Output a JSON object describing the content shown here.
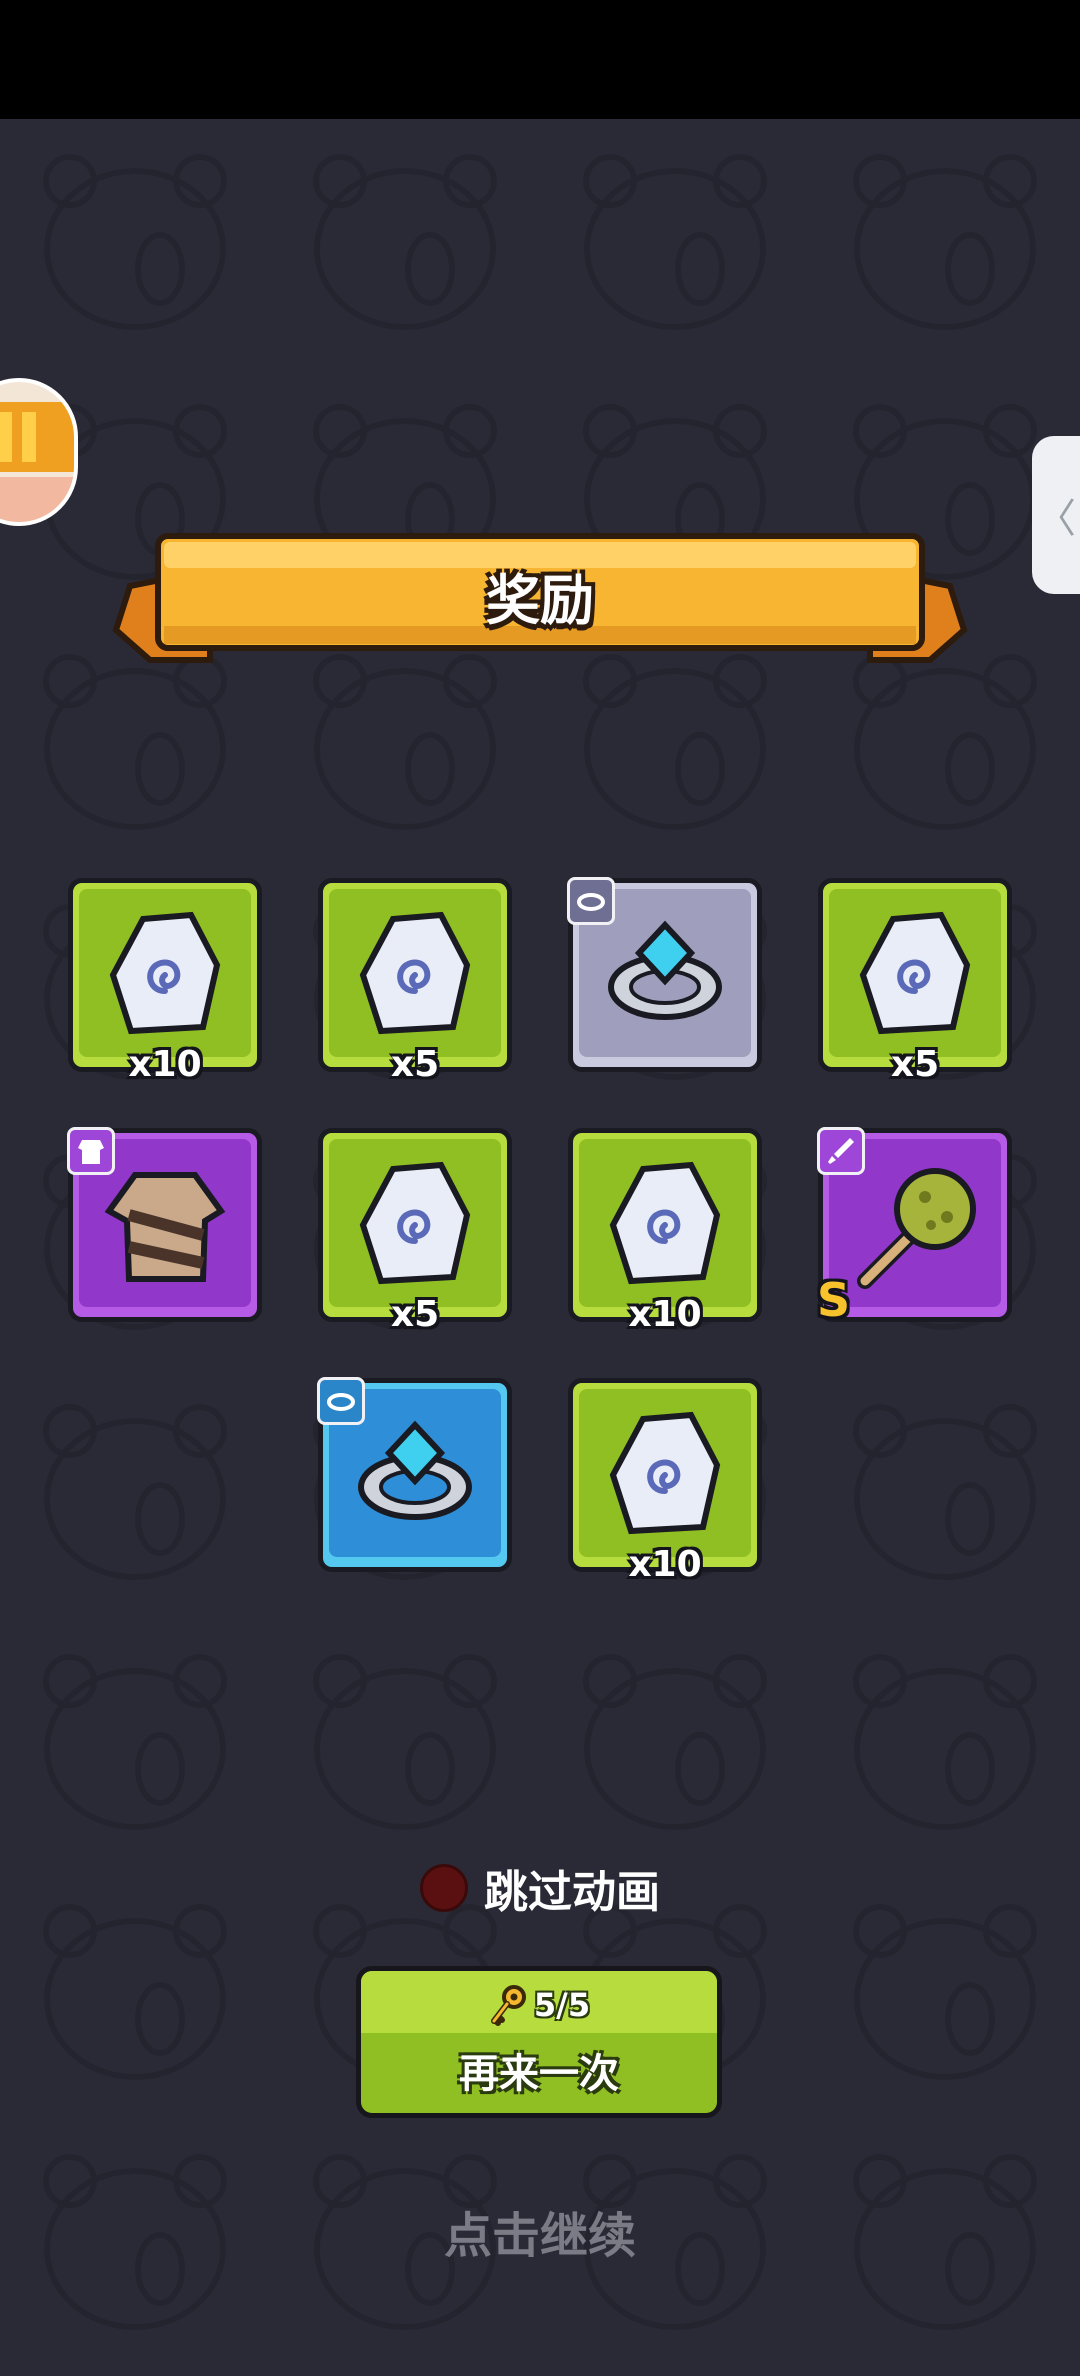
{
  "banner": {
    "title": "奖励"
  },
  "rewards": [
    {
      "kind": "rune-stone",
      "tile": "green",
      "qty": "x10"
    },
    {
      "kind": "rune-stone",
      "tile": "green",
      "qty": "x5"
    },
    {
      "kind": "ring",
      "tile": "gray",
      "badge": "ring-icon"
    },
    {
      "kind": "rune-stone",
      "tile": "green",
      "qty": "x5"
    },
    {
      "kind": "armor",
      "tile": "purple",
      "badge": "armor-icon"
    },
    {
      "kind": "rune-stone",
      "tile": "green",
      "qty": "x5"
    },
    {
      "kind": "rune-stone",
      "tile": "green",
      "qty": "x10"
    },
    {
      "kind": "mace",
      "tile": "purple",
      "badge": "sword-icon",
      "grade": "S"
    },
    {
      "kind": "ring",
      "tile": "blue",
      "badge": "ring-icon"
    },
    {
      "kind": "rune-stone",
      "tile": "green",
      "qty": "x10"
    }
  ],
  "skip": {
    "label": "跳过动画"
  },
  "again_button": {
    "keys": "5/5",
    "label": "再来一次"
  },
  "continue_text": "点击继续",
  "side_tab": {
    "glyph": "〈"
  },
  "colors": {
    "banner": "#f7b531",
    "green_tile": "#8fbf22",
    "purple_tile": "#9137c9",
    "blue_tile": "#2e8fd8",
    "gray_tile": "#9f9fbd"
  }
}
